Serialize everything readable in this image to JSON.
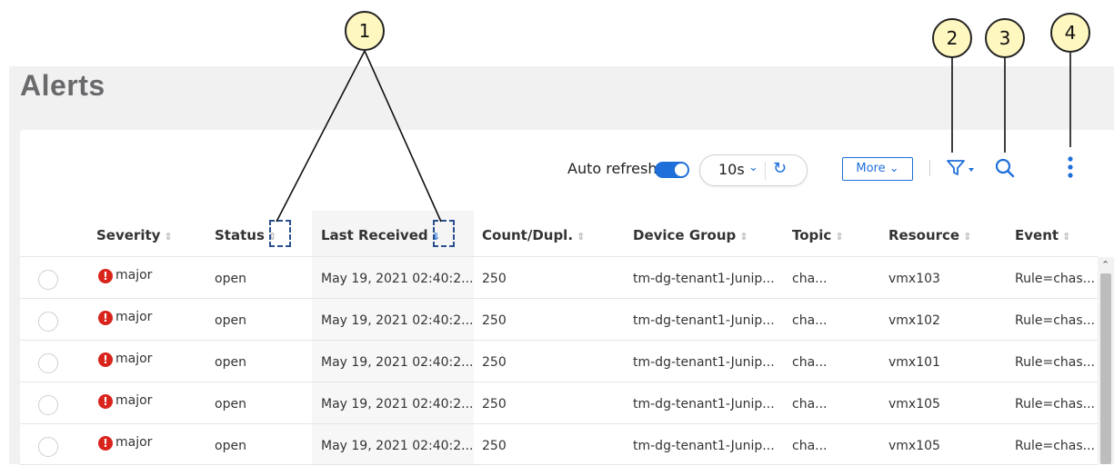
{
  "page": {
    "title": "Alerts"
  },
  "toolbar": {
    "auto_refresh_label": "Auto refresh",
    "auto_refresh_on": true,
    "interval_value": "10s",
    "more_label": "More",
    "icons": [
      "chevron-down-icon",
      "refresh-icon",
      "filter-icon",
      "search-icon",
      "kebab-menu-icon"
    ]
  },
  "table": {
    "columns": [
      "Severity",
      "Status",
      "Last Received",
      "Count/Dupl.",
      "Device Group",
      "Topic",
      "Resource",
      "Event"
    ],
    "rows": [
      {
        "severity": "major",
        "status": "open",
        "last_received": "May 19, 2021 02:40:2...",
        "count": "250",
        "device_group": "tm-dg-tenant1-Junip...",
        "topic": "cha...",
        "resource": "vmx103",
        "event": "Rule=chas..."
      },
      {
        "severity": "major",
        "status": "open",
        "last_received": "May 19, 2021 02:40:2...",
        "count": "250",
        "device_group": "tm-dg-tenant1-Junip...",
        "topic": "cha...",
        "resource": "vmx102",
        "event": "Rule=chas..."
      },
      {
        "severity": "major",
        "status": "open",
        "last_received": "May 19, 2021 02:40:2...",
        "count": "250",
        "device_group": "tm-dg-tenant1-Junip...",
        "topic": "cha...",
        "resource": "vmx101",
        "event": "Rule=chas..."
      },
      {
        "severity": "major",
        "status": "open",
        "last_received": "May 19, 2021 02:40:2...",
        "count": "250",
        "device_group": "tm-dg-tenant1-Junip...",
        "topic": "cha...",
        "resource": "vmx105",
        "event": "Rule=chas..."
      },
      {
        "severity": "major",
        "status": "open",
        "last_received": "May 19, 2021 02:40:2...",
        "count": "250",
        "device_group": "tm-dg-tenant1-Junip...",
        "topic": "cha...",
        "resource": "vmx105",
        "event": "Rule=chas..."
      }
    ]
  },
  "callouts": [
    "1",
    "2",
    "3",
    "4"
  ],
  "colors": {
    "accent": "#1e6fd9",
    "severity_major": "#d9241c",
    "callout_fill": "#fff7c0",
    "highlight_box": "#2a4f8f"
  }
}
